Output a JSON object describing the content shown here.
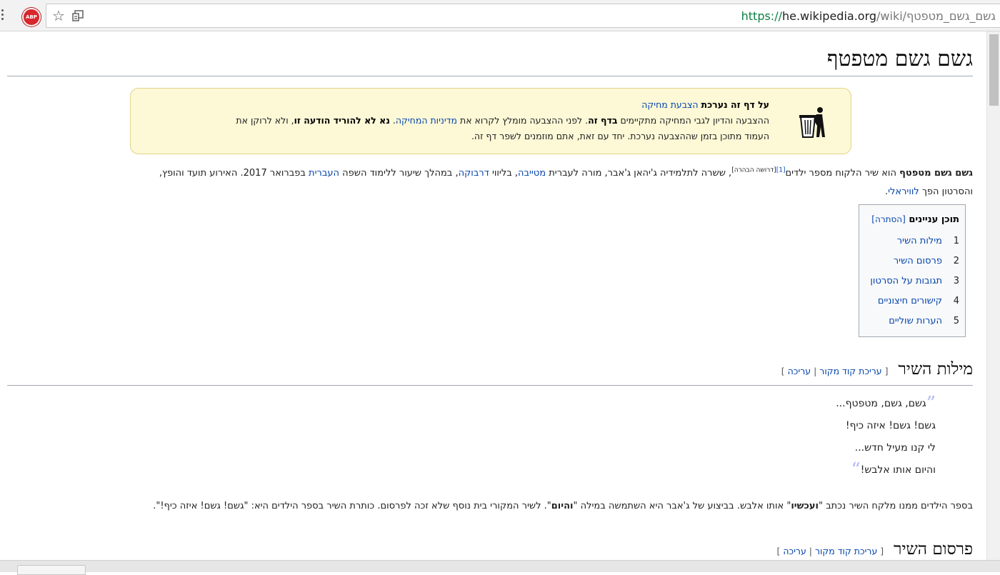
{
  "browser": {
    "abp_label": "ABP",
    "url_scheme": "https://",
    "url_host": "he.wikipedia.org",
    "url_path": "/wiki/גשם_גשם_מטפטף"
  },
  "article": {
    "title": "גשם גשם מטפטף",
    "notice": {
      "lead_bold": "על דף זה נערכת",
      "lead_link": "הצבעת מחיקה",
      "line1_a": "ההצבעה והדיון לגבי המחיקה מתקיימים",
      "line1_link": "בדף זה",
      "line1_b": ". לפני ההצבעה מומלץ לקרוא את",
      "line1_link2": "מדיניות המחיקה",
      "line1_c": ".",
      "line1_bold": "נא לא להוריד הודעה זו",
      "line1_d": ", ולא לרוקן את",
      "line2": "העמוד מתוכן בזמן שההצבעה נערכת. יחד עם זאת, אתם מוזמנים לשפר דף זה."
    },
    "intro": {
      "bold": "גשם גשם מטפטף",
      "t1": " הוא שיר הלקוח מספר ילדים",
      "ref": "[1]",
      "ref_note": "[דרושה הבהרה]",
      "t2": ", ששרה לתלמידיה ג'יהאן ג'אבר, מורה לעברית ",
      "link1": "מטייבה",
      "t3": ", בליווי ",
      "link2": "דרבוקה",
      "t4": ", במהלך שיעור ללימוד השפה ",
      "link3": "העברית",
      "t5": " בפברואר 2017. האירוע תועד והופץ,",
      "t6": "והסרטון הפך ",
      "link4": "לוויראלי",
      "t7": "."
    },
    "toc": {
      "title": "תוכן עניינים",
      "toggle": "[הסתרה]",
      "items": [
        {
          "num": "1",
          "label": "מילות השיר"
        },
        {
          "num": "2",
          "label": "פרסום השיר"
        },
        {
          "num": "3",
          "label": "תגובות על הסרטון"
        },
        {
          "num": "4",
          "label": "קישורים חיצוניים"
        },
        {
          "num": "5",
          "label": "הערות שוליים"
        }
      ]
    },
    "sections": {
      "lyrics_title": "מילות השיר",
      "publication_title": "פרסום השיר",
      "edit_open": "[ ",
      "edit_source": "עריכת קוד מקור",
      "edit_sep": " | ",
      "edit": "עריכה",
      "edit_close": " ]"
    },
    "poem": {
      "open_quote": "”",
      "close_quote": "“",
      "lines": [
        "גשם, גשם, מטפטף...",
        "גשם! גשם! איזה כיף!",
        "לי קנו מעיל חדש...",
        "והיום אותו אלבש!"
      ]
    },
    "after_poem": {
      "t1": "בספר הילדים ממנו מלקח השיר נכתב \"",
      "b1": "ועכשיו",
      "t2": "\" אותו אלבש. בביצוע של ג'אבר היא השתמשה במילה \"",
      "b2": "והיום",
      "t3": "\". לשיר המקורי בית נוסף שלא זכה לפרסום. כותרת השיר בספר הילדים היא: \"גשם! גשם! איזה כיף!\"."
    }
  }
}
